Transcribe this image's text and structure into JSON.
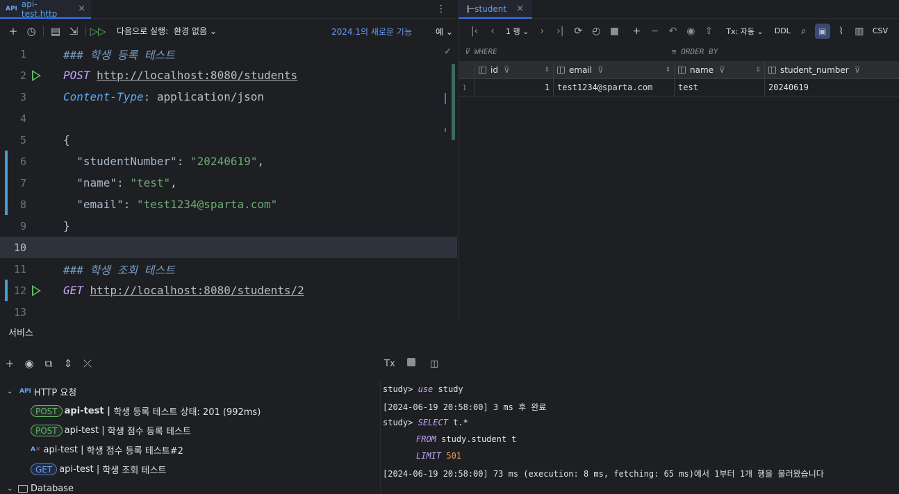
{
  "editor": {
    "tab": {
      "icon": "API",
      "label": "api-test.http"
    },
    "toolbar": {
      "run_with_label": "다음으로 실행:",
      "env_label": "환경 없음",
      "new_features": "2024.1의 새로운 기능",
      "yes_label": "예"
    },
    "lines": [
      {
        "n": "1",
        "text": "### 학생 등록 테스트"
      },
      {
        "n": "2",
        "method": "POST",
        "url": "http://localhost:8080/students"
      },
      {
        "n": "3",
        "header_key": "Content-Type",
        "header_val": ": application/json"
      },
      {
        "n": "4"
      },
      {
        "n": "5",
        "text": "{"
      },
      {
        "n": "6",
        "key": "\"studentNumber\"",
        "val": "\"20240619\"",
        "tail": ","
      },
      {
        "n": "7",
        "key": "\"name\"",
        "val": "\"test\"",
        "tail": ","
      },
      {
        "n": "8",
        "key": "\"email\"",
        "val": "\"test1234@sparta.com\"",
        "tail": ""
      },
      {
        "n": "9",
        "text": "}"
      },
      {
        "n": "10"
      },
      {
        "n": "11",
        "text": "### 학생 조회 테스트"
      },
      {
        "n": "12",
        "method": "GET",
        "url": "http://localhost:8080/students/2"
      },
      {
        "n": "13"
      }
    ]
  },
  "grid": {
    "tab_label": "student",
    "page_label": "1 행",
    "tx_label": "Tx: 자동",
    "ddl_label": "DDL",
    "csv_label": "CSV",
    "where_label": "WHERE",
    "orderby_label": "ORDER BY",
    "columns": [
      "id",
      "email",
      "name",
      "student_number"
    ],
    "rows": [
      {
        "rownum": "1",
        "id": "1",
        "email": "test1234@sparta.com",
        "name": "test",
        "student_number": "20240619"
      }
    ]
  },
  "services": {
    "title": "서비스",
    "http_group": "HTTP 요청",
    "items": [
      {
        "badge": "POST",
        "file": "api-test",
        "sep": " | ",
        "name": "학생 등록 테스트 상태: 201 (992ms)"
      },
      {
        "badge": "POST",
        "file": "api-test",
        "sep": " | ",
        "name": "학생 점수 등록 테스트"
      },
      {
        "badge": "",
        "file": "api-test",
        "sep": " | ",
        "name": "학생 점수 등록 테스트#2"
      },
      {
        "badge": "GET",
        "file": "api-test",
        "sep": " | ",
        "name": "학생 조회 테스트"
      }
    ],
    "database_group": "Database"
  },
  "console": {
    "tx_label": "Tx",
    "prompt": "study>",
    "use_kw": "use",
    "use_arg": "study",
    "line2": "[2024-06-19 20:58:00] 3 ms 후 완료",
    "select_kw": "SELECT",
    "select_arg": "t.*",
    "from_kw": "FROM",
    "from_arg": "study.student t",
    "limit_kw": "LIMIT",
    "limit_val": "501",
    "line6": "[2024-06-19 20:58:00] 73 ms (execution: 8 ms, fetching: 65 ms)에서 1부터 1개 행을 불러왔습니다"
  },
  "colors": {
    "accent": "#3574f0",
    "run_green": "#5fb865",
    "background": "#1e1f22"
  }
}
